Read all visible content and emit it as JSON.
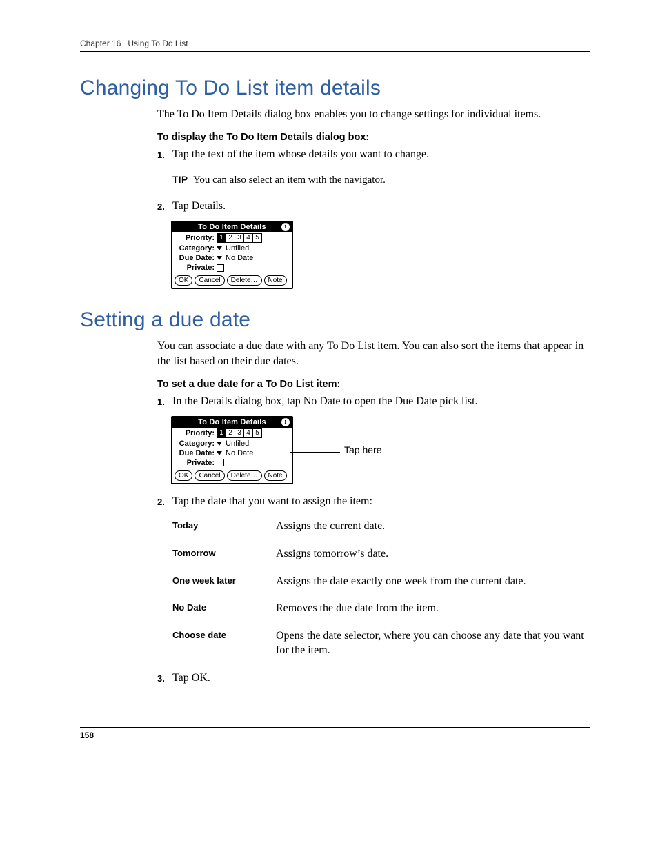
{
  "header": {
    "chapter": "Chapter 16",
    "title": "Using To Do List"
  },
  "section1": {
    "heading": "Changing To Do List item details",
    "intro": "The To Do Item Details dialog box enables you to change settings for individual items.",
    "subhead": "To display the To Do Item Details dialog box:",
    "steps": {
      "s1_num": "1.",
      "s1_text": "Tap the text of the item whose details you want to change.",
      "tip_label": "TIP",
      "tip_text": "You can also select an item with the navigator.",
      "s2_num": "2.",
      "s2_text": "Tap Details."
    }
  },
  "dialog": {
    "title": "To Do Item Details",
    "priority_label": "Priority:",
    "priority": [
      "1",
      "2",
      "3",
      "4",
      "5"
    ],
    "category_label": "Category:",
    "category_value": "Unfiled",
    "duedate_label": "Due Date:",
    "duedate_value": "No Date",
    "private_label": "Private:",
    "btn_ok": "OK",
    "btn_cancel": "Cancel",
    "btn_delete": "Delete…",
    "btn_note": "Note"
  },
  "section2": {
    "heading": "Setting a due date",
    "intro": "You can associate a due date with any To Do List item. You can also sort the items that appear in the list based on their due dates.",
    "subhead": "To set a due date for a To Do List item:",
    "steps": {
      "s1_num": "1.",
      "s1_text": "In the Details dialog box, tap No Date to open the Due Date pick list.",
      "callout": "Tap here",
      "s2_num": "2.",
      "s2_text": "Tap the date that you want to assign the item:",
      "s3_num": "3.",
      "s3_text": "Tap OK."
    },
    "options": [
      {
        "term": "Today",
        "desc": "Assigns the current date."
      },
      {
        "term": "Tomorrow",
        "desc": "Assigns tomorrow’s date."
      },
      {
        "term": "One week later",
        "desc": "Assigns the date exactly one week from the current date."
      },
      {
        "term": "No Date",
        "desc": "Removes the due date from the item."
      },
      {
        "term": "Choose date",
        "desc": "Opens the date selector, where you can choose any date that you want for the item."
      }
    ]
  },
  "page_number": "158"
}
